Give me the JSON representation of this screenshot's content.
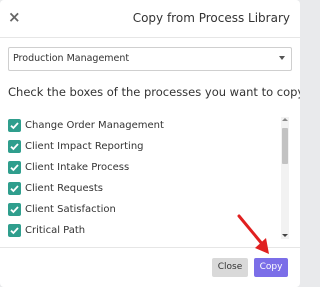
{
  "dialog": {
    "title": "Copy from Process Library",
    "close_glyph": "×"
  },
  "library_select": {
    "value": "Production Management"
  },
  "instructions": "Check the boxes of the processes you want to copy",
  "processes": [
    {
      "label": "Change Order Management",
      "checked": true
    },
    {
      "label": "Client Impact Reporting",
      "checked": true
    },
    {
      "label": "Client Intake Process",
      "checked": true
    },
    {
      "label": "Client Requests",
      "checked": true
    },
    {
      "label": "Client Satisfaction",
      "checked": true
    },
    {
      "label": "Critical Path",
      "checked": true
    }
  ],
  "footer": {
    "close_label": "Close",
    "copy_label": "Copy"
  },
  "colors": {
    "checkbox": "#2f9e8d",
    "copy_button": "#7b6ee8",
    "annotation_arrow": "#e02020"
  }
}
